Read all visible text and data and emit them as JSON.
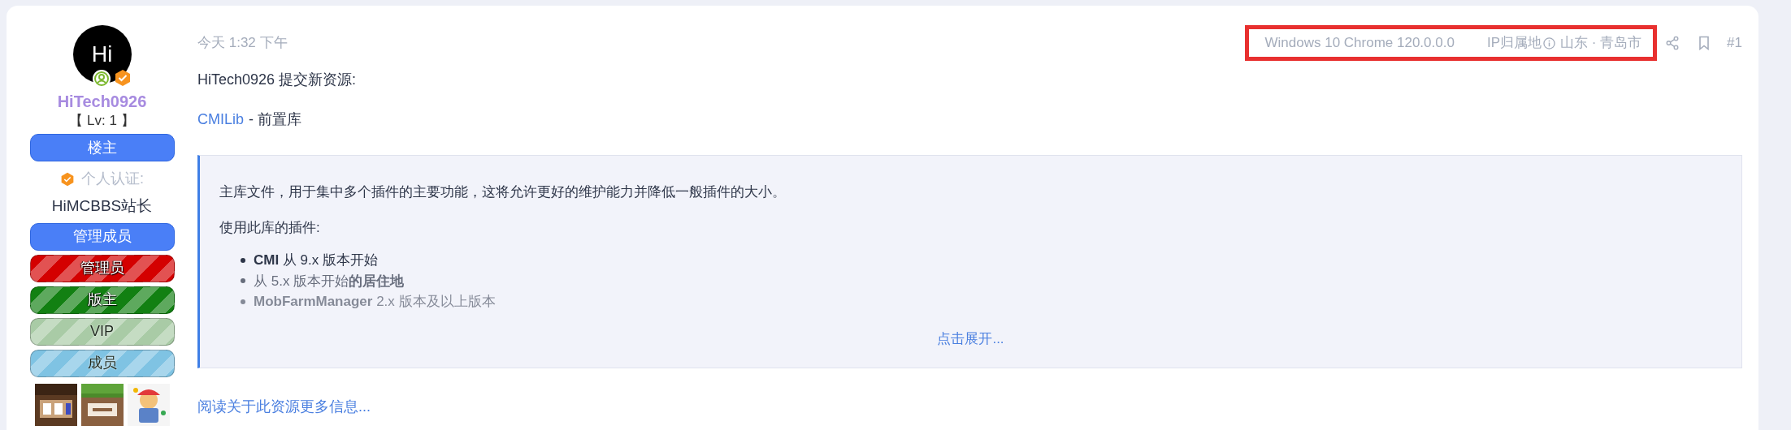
{
  "author": {
    "avatar_initials": "Hi",
    "name": "HiTech0926",
    "level": "【 Lv: 1 】",
    "verification_label": "个人认证:",
    "verification_title": "HiMCBBS站长",
    "groups": [
      {
        "label": "楼主",
        "kind": "solid",
        "color": "#4a7ff7"
      },
      {
        "label": "管理成员",
        "kind": "solid",
        "color": "#4a7ff7"
      },
      {
        "label": "管理员",
        "kind": "striped",
        "color": "#d40000"
      },
      {
        "label": "版主",
        "kind": "striped",
        "color": "#128012"
      },
      {
        "label": "VIP",
        "kind": "striped",
        "color": "#a9cba6"
      },
      {
        "label": "成员",
        "kind": "striped",
        "color": "#7fc3e3"
      }
    ]
  },
  "post": {
    "time": "今天 1:32 下午",
    "device": "Windows 10 Chrome 120.0.0.0",
    "ip_label": "IP归属地",
    "ip_location": "山东 · 青岛市",
    "post_number": "#1",
    "intro": "HiTech0926 提交新资源:",
    "resource_link": "CMILib",
    "resource_suffix": "- 前置库",
    "quote": {
      "paragraphs": [
        "主库文件，用于集中多个插件的主要功能，这将允许更好的维护能力并降低一般插件的大小。",
        "使用此库的插件:"
      ],
      "items": [
        "**CMI** 从 9.x 版本开始",
        "从 5.x 版本开始**的居住地**",
        "**MobFarmManager** 2.x 版本及以上版本"
      ],
      "expand": "点击展开..."
    },
    "read_more": "阅读关于此资源更多信息..."
  }
}
